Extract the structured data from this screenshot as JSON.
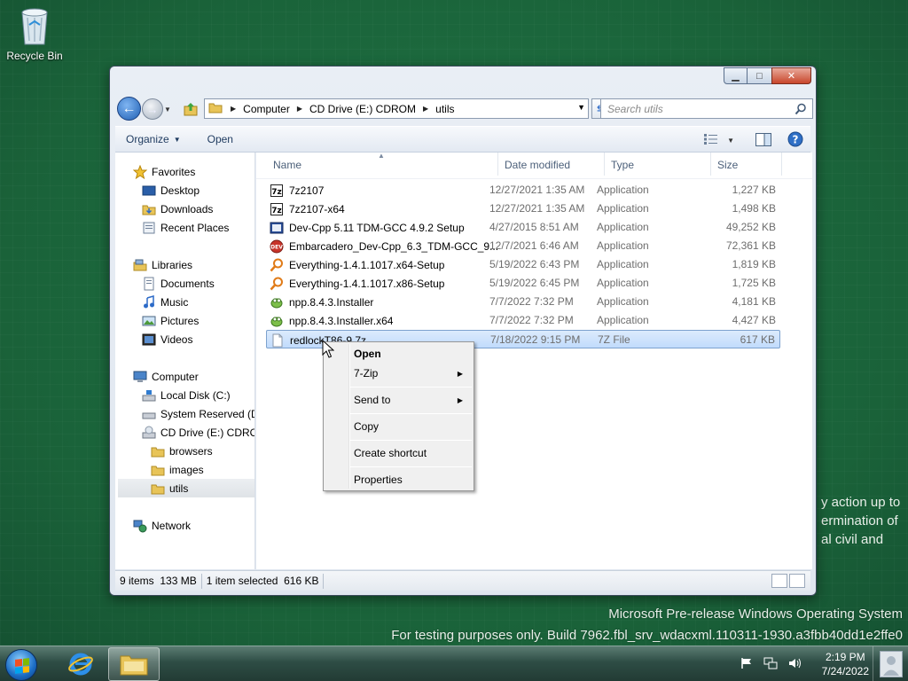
{
  "desktop": {
    "recycle_bin_label": "Recycle Bin",
    "side_text_lines": [
      "y action up to",
      "ermination of",
      "al civil and"
    ],
    "watermark_line1": "Microsoft Pre-release Windows Operating System",
    "watermark_line2": "For testing purposes only. Build 7962.fbl_srv_wdacxml.110311-1930.a3fbb40dd1e2ffe0"
  },
  "window": {
    "address": {
      "crumbs": [
        "Computer",
        "CD Drive (E:) CDROM",
        "utils"
      ]
    },
    "search_placeholder": "Search utils",
    "toolbar": {
      "organize_label": "Organize",
      "open_label": "Open"
    },
    "nav": {
      "favorites": "Favorites",
      "desktop": "Desktop",
      "downloads": "Downloads",
      "recent_places": "Recent Places",
      "libraries": "Libraries",
      "documents": "Documents",
      "music": "Music",
      "pictures": "Pictures",
      "videos": "Videos",
      "computer": "Computer",
      "local_disk": "Local Disk (C:)",
      "system_reserved": "System Reserved (D:",
      "cd_drive": "CD Drive (E:) CDROM",
      "browsers": "browsers",
      "images": "images",
      "utils": "utils",
      "network": "Network"
    },
    "columns": {
      "name": "Name",
      "date_modified": "Date modified",
      "type": "Type",
      "size": "Size"
    },
    "files": [
      {
        "name": "7z2107",
        "date": "12/27/2021 1:35 AM",
        "type": "Application",
        "size": "1,227 KB",
        "icon": "7zip-icon"
      },
      {
        "name": "7z2107-x64",
        "date": "12/27/2021 1:35 AM",
        "type": "Application",
        "size": "1,498 KB",
        "icon": "7zip-icon"
      },
      {
        "name": "Dev-Cpp 5.11 TDM-GCC 4.9.2 Setup",
        "date": "4/27/2015 8:51 AM",
        "type": "Application",
        "size": "49,252 KB",
        "icon": "devcpp-icon"
      },
      {
        "name": "Embarcadero_Dev-Cpp_6.3_TDM-GCC_9....",
        "date": "12/7/2021 6:46 AM",
        "type": "Application",
        "size": "72,361 KB",
        "icon": "embarcadero-icon"
      },
      {
        "name": "Everything-1.4.1.1017.x64-Setup",
        "date": "5/19/2022 6:43 PM",
        "type": "Application",
        "size": "1,819 KB",
        "icon": "everything-icon"
      },
      {
        "name": "Everything-1.4.1.1017.x86-Setup",
        "date": "5/19/2022 6:45 PM",
        "type": "Application",
        "size": "1,725 KB",
        "icon": "everything-icon"
      },
      {
        "name": "npp.8.4.3.Installer",
        "date": "7/7/2022 7:32 PM",
        "type": "Application",
        "size": "4,181 KB",
        "icon": "notepadpp-icon"
      },
      {
        "name": "npp.8.4.3.Installer.x64",
        "date": "7/7/2022 7:32 PM",
        "type": "Application",
        "size": "4,427 KB",
        "icon": "notepadpp-icon"
      },
      {
        "name": "redlockT86-9.7z",
        "date": "7/18/2022 9:15 PM",
        "type": "7Z File",
        "size": "617 KB",
        "icon": "blank-file-icon"
      }
    ],
    "status": {
      "items": "9 items",
      "size": "133 MB",
      "selected": "1 item selected",
      "selected_size": "616 KB"
    }
  },
  "context_menu": {
    "open": "Open",
    "sevenzip": "7-Zip",
    "send_to": "Send to",
    "copy": "Copy",
    "create_shortcut": "Create shortcut",
    "properties": "Properties"
  },
  "taskbar": {
    "time": "2:19 PM",
    "date": "7/24/2022"
  }
}
